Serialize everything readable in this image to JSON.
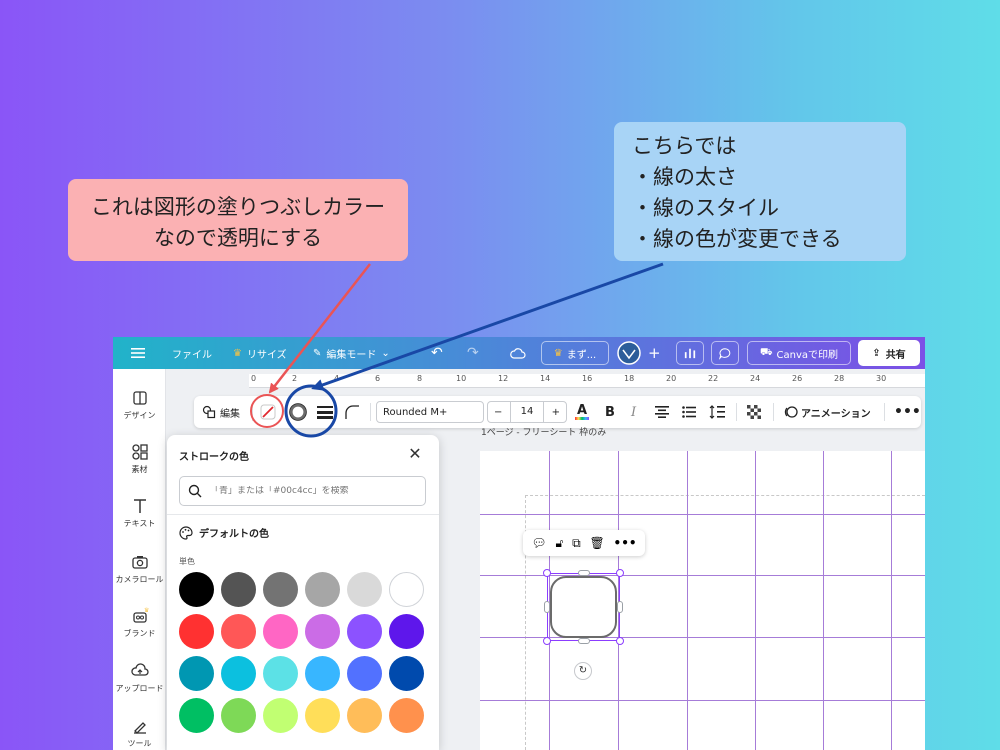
{
  "callouts": {
    "fill": {
      "lines": [
        "これは図形の塗りつぶしカラー",
        "なので透明にする"
      ],
      "color": "#fbb1b3"
    },
    "stroke": {
      "lines": [
        "こちらでは",
        "・線の太さ",
        "・線のスタイル",
        "・線の色が変更できる"
      ],
      "color": "#a8d4f6"
    }
  },
  "topbar": {
    "file": "ファイル",
    "resize": "リサイズ",
    "edit_mode": "編集モード",
    "upgrade": "まず...",
    "print": "Canvaで印刷",
    "share": "共有"
  },
  "sidebar": {
    "items": [
      {
        "label": "デザイン",
        "icon": "design-icon"
      },
      {
        "label": "素材",
        "icon": "elements-icon"
      },
      {
        "label": "テキスト",
        "icon": "text-icon"
      },
      {
        "label": "カメラロール",
        "icon": "camera-icon"
      },
      {
        "label": "ブランド",
        "icon": "brand-icon"
      },
      {
        "label": "アップロード",
        "icon": "upload-icon"
      },
      {
        "label": "ツール",
        "icon": "tools-icon"
      }
    ]
  },
  "ruler": {
    "ticks": [
      "0",
      "2",
      "4",
      "6",
      "8",
      "10",
      "12",
      "14",
      "16",
      "18",
      "20",
      "22",
      "24",
      "26",
      "28",
      "30"
    ]
  },
  "toolbar": {
    "edit": "編集",
    "font": "Rounded M+",
    "font_size": "14",
    "minus": "−",
    "plus": "+",
    "animation": "アニメーション",
    "bold": "B",
    "italic": "I"
  },
  "page_title": "1ページ - フリーシート 枠のみ",
  "panel": {
    "title": "ストロークの色",
    "search_placeholder": "「青」または「#00c4cc」を検索",
    "default_colors": "デフォルトの色",
    "solid": "単色",
    "swatches": [
      [
        "#000000",
        "#545454",
        "#737373",
        "#a6a6a6",
        "#d9d9d9",
        "#ffffff"
      ],
      [
        "#ff3131",
        "#ff5757",
        "#ff66c4",
        "#cb6ce6",
        "#8c52ff",
        "#5e17eb"
      ],
      [
        "#0097b2",
        "#0cc0df",
        "#5ce1e6",
        "#38b6ff",
        "#5271ff",
        "#004aad"
      ],
      [
        "#00bf63",
        "#7ed957",
        "#c1ff72",
        "#ffde59",
        "#ffbd59",
        "#ff914d"
      ]
    ]
  }
}
